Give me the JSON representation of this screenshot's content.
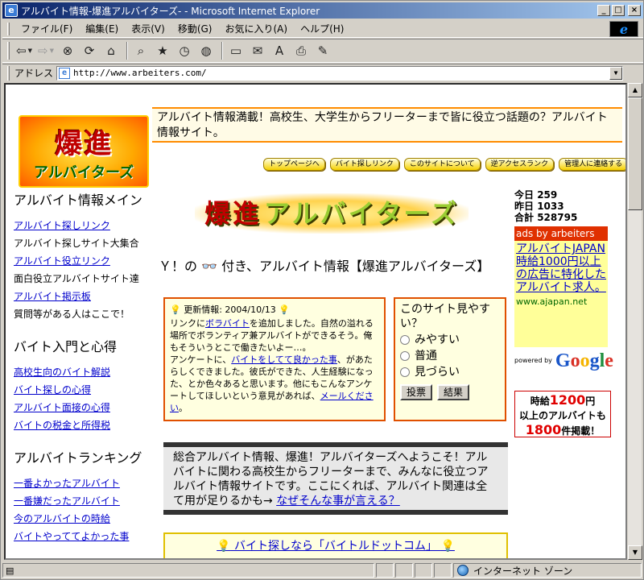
{
  "window": {
    "title": "アルバイト情報-爆進アルバイターズ- - Microsoft Internet Explorer",
    "min_label": "_",
    "max_label": "□",
    "close_label": "×"
  },
  "menu": {
    "items": [
      "ファイル(F)",
      "編集(E)",
      "表示(V)",
      "移動(G)",
      "お気に入り(A)",
      "ヘルプ(H)"
    ],
    "ie_logo": "e"
  },
  "toolbar": {
    "icons": [
      "back-icon",
      "forward-icon",
      "stop-icon",
      "refresh-icon",
      "home-icon",
      "search-icon",
      "favorites-icon",
      "history-icon",
      "channels-icon",
      "fullscreen-icon",
      "mail-icon",
      "font-icon",
      "print-icon",
      "edit-icon"
    ]
  },
  "address": {
    "label": "アドレス",
    "url": "http://www.arbeiters.com/"
  },
  "status": {
    "zone": "インターネット ゾーン"
  },
  "page": {
    "logo_top": "爆進",
    "logo_bottom": "アルバイターズ",
    "banner_text": "アルバイト情報満載！高校生、大学生からフリーターまで皆に役立つ話題の？アルバイト情報サイト。",
    "nav": [
      "トップページへ",
      "バイト探しリンク",
      "このサイトについて",
      "逆アクセスランク",
      "管理人に連絡する"
    ],
    "sidebar": [
      {
        "title": "アルバイト情報メイン",
        "items": [
          {
            "text": "アルバイト探しリンク",
            "link": true
          },
          {
            "text": "アルバイト探しサイト大集合",
            "link": false
          },
          {
            "text": "アルバイト役立リンク",
            "link": true
          },
          {
            "text": "面白役立アルバイトサイト達",
            "link": false
          },
          {
            "text": "アルバイト掲示板",
            "link": true
          },
          {
            "text": "質問等がある人はここで！",
            "link": false
          }
        ]
      },
      {
        "title": "バイト入門と心得",
        "items": [
          {
            "text": "高校生向のバイト解説",
            "link": true
          },
          {
            "text": "バイト探しの心得",
            "link": true
          },
          {
            "text": "アルバイト面接の心得",
            "link": true
          },
          {
            "text": "バイトの税金と所得税",
            "link": true
          }
        ]
      },
      {
        "title": "アルバイトランキング",
        "items": [
          {
            "text": "一番よかったアルバイト",
            "link": true
          },
          {
            "text": "一番嫌だったアルバイト",
            "link": true
          },
          {
            "text": "今のアルバイトの時給",
            "link": true
          },
          {
            "text": "バイトやっててよかった事",
            "link": true
          }
        ]
      }
    ],
    "center_logo_a": "爆進",
    "center_logo_b": "アルバイターズ",
    "heading_pre": "Ｙ！の",
    "heading_glasses": "👓",
    "heading_post": "付き、アルバイト情報【爆進アルバイターズ】",
    "update": {
      "title": "更新情報: 2004/10/13",
      "line1_pre": "リンクに",
      "line1_link": "ボラバイト",
      "line1_post": "を追加しました。自然の溢れる場所でボランティア兼アルバイトができるそう。俺もそういうとこで働きたいよー…。",
      "line2_pre": "アンケートに、",
      "line2_link": "バイトをしてて良かった事",
      "line2_post": "、があたらしくできました。彼氏ができた、人生経験になった、とか色々あると思います。他にもこんなアンケートしてほしいという意見があれば、",
      "line2_link2": "メールください",
      "line2_end": "。"
    },
    "poll": {
      "title": "このサイト見やすい？",
      "options": [
        "みやすい",
        "普通",
        "見づらい"
      ],
      "vote": "投票",
      "result": "結果"
    },
    "welcome_text": "総合アルバイト情報、爆進！アルバイターズへようこそ！アルバイトに関わる高校生からフリーターまで、みんなに役立つアルバイト情報サイトです。ここにくれば、アルバイト関連は全て用が足りるかも→",
    "welcome_link": "なぜそんな事が言える？",
    "bottom_link": "バイト探しなら「バイトルドットコム」",
    "counter": {
      "today_label": "今日",
      "today": "259",
      "yesterday_label": "昨日",
      "yesterday": "1033",
      "total_label": "合計",
      "total": "528795"
    },
    "ad": {
      "header": "ads by arbeiters",
      "text": "アルバイトJAPAN 時給1000円以上の広告に特化したアルバイト求人。",
      "url": "www.ajapan.net"
    },
    "google": {
      "powered": "powered by",
      "logo": "Google"
    },
    "banner2": {
      "l1_pre": "時給",
      "l1_num": "1200",
      "l1_post": "円",
      "l2": "以上のアルバイトも",
      "l3_num": "1800",
      "l3_post": "件掲載！"
    }
  },
  "colors": {
    "title_bar": "#0a246a",
    "accent_orange": "#ff8c00",
    "link": "#0000cc"
  }
}
